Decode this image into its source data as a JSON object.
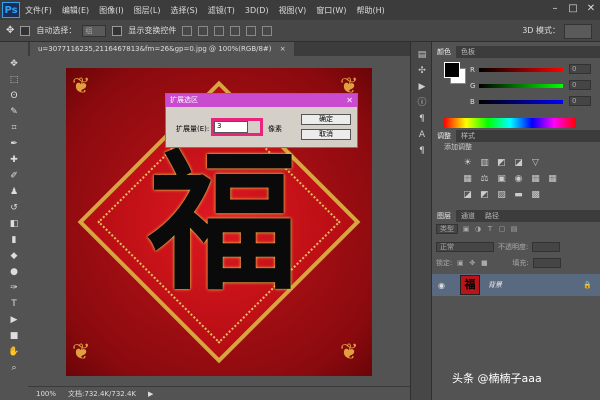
{
  "app": {
    "logo": "Ps",
    "menu": [
      "文件(F)",
      "编辑(E)",
      "图像(I)",
      "图层(L)",
      "选择(S)",
      "滤镜(T)",
      "3D(D)",
      "视图(V)",
      "窗口(W)",
      "帮助(H)"
    ],
    "window_controls": [
      "–",
      "□",
      "✕"
    ]
  },
  "options_bar": {
    "auto_select_label": "自动选择：",
    "auto_select_value": "组",
    "show_transform_label": "显示变换控件",
    "mode_3d_label": "3D 模式："
  },
  "document": {
    "tab_title": "u=3077116235,2116467813&fm=26&gp=0.jpg @ 100%(RGB/8#)",
    "tab_close": "×",
    "artwork_char": "福",
    "zoom": "100%",
    "doc_size": "文档:732.4K/732.4K"
  },
  "dialog": {
    "title": "扩展选区",
    "close": "✕",
    "expand_label": "扩展量(E):",
    "expand_value": "3",
    "unit": "像素",
    "ok_label": "确定",
    "cancel_label": "取消",
    "highlight_color": "#e8257a",
    "title_color": "#c84bd0"
  },
  "color_panel": {
    "tabs": [
      "颜色",
      "色板"
    ],
    "channels": [
      {
        "label": "R",
        "value": "0"
      },
      {
        "label": "G",
        "value": "0"
      },
      {
        "label": "B",
        "value": "0"
      }
    ]
  },
  "adjust_panel": {
    "tabs": [
      "调整",
      "样式"
    ],
    "title": "添加调整",
    "row1_icons": [
      "☀",
      "▥",
      "◩",
      "◪",
      "▽"
    ],
    "row2_icons": [
      "▦",
      "⚖",
      "▣",
      "◉",
      "▦",
      "▦"
    ],
    "row3_icons": [
      "◪",
      "◩",
      "▨",
      "▬",
      "▩"
    ]
  },
  "layers_panel": {
    "tabs": [
      "图层",
      "通道",
      "路径"
    ],
    "filter_label": "类型",
    "blend_mode": "正常",
    "opacity_label": "不透明度:",
    "lock_label": "锁定:",
    "fill_label": "填充:",
    "layer_name": "背景",
    "layer_thumb_char": "福",
    "eye_icon": "◉",
    "lock_icon": "🔒"
  },
  "watermark": "头条 @楠楠子aaa"
}
